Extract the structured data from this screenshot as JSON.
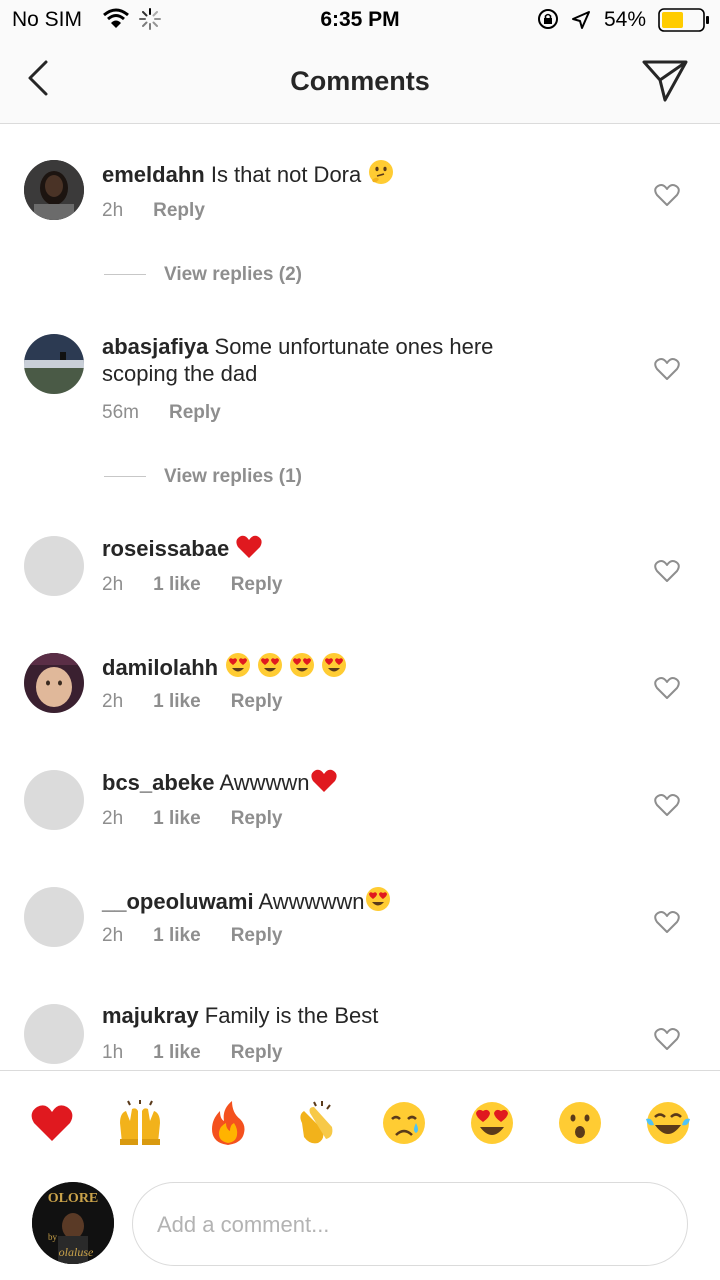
{
  "status_bar": {
    "carrier": "No SIM",
    "time": "6:35 PM",
    "battery": "54%",
    "battery_level": 0.54,
    "battery_color": "#ffcc00"
  },
  "nav": {
    "title": "Comments"
  },
  "comments": [
    {
      "username": "emeldahn",
      "text": "Is that not Dora",
      "time": "2h",
      "likes": "",
      "reply": "Reply",
      "avatar": "photo-dark"
    },
    {
      "username": "abasjafiya",
      "text": "Some unfortunate ones here scoping the dad",
      "time": "56m",
      "likes": "",
      "reply": "Reply",
      "avatar": "photo-landscape"
    },
    {
      "username": "roseissabae",
      "text": "",
      "time": "2h",
      "likes": "1 like",
      "reply": "Reply",
      "avatar": "placeholder"
    },
    {
      "username": "damilolahh",
      "text": "",
      "time": "2h",
      "likes": "1 like",
      "reply": "Reply",
      "avatar": "photo-child"
    },
    {
      "username": "bcs_abeke",
      "text": "Awwwwn",
      "time": "2h",
      "likes": "1 like",
      "reply": "Reply",
      "avatar": "placeholder"
    },
    {
      "username": "__opeoluwami",
      "text": "Awwwwwn",
      "time": "2h",
      "likes": "1 like",
      "reply": "Reply",
      "avatar": "placeholder"
    },
    {
      "username": "majukray",
      "text": "Family is the Best",
      "time": "1h",
      "likes": "1 like",
      "reply": "Reply",
      "avatar": "placeholder"
    }
  ],
  "view_replies": [
    "View replies (2)",
    "View replies (1)"
  ],
  "emoji_bar": [
    "red-heart",
    "raising-hands",
    "fire",
    "clapping-hands",
    "crying-face",
    "heart-eyes",
    "astonished-face",
    "tears-of-joy"
  ],
  "input": {
    "placeholder": "Add a comment..."
  },
  "my_avatar_text": {
    "top": "OLORE",
    "by": "by",
    "name": "olaluse"
  },
  "colors": {
    "text": "#262626",
    "muted": "#8e8e8e",
    "divider": "#dbdbdb",
    "heart_red": "#e0191f",
    "emoji_yellow": "#ffcc33"
  }
}
